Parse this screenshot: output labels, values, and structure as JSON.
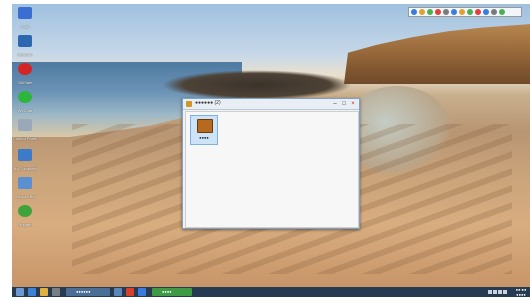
{
  "desktop": {
    "icons": [
      {
        "name": "computer-icon",
        "label": "Lilab",
        "color": "#3a6fd1"
      },
      {
        "name": "network-icon",
        "label": "Network",
        "color": "#2c67b0"
      },
      {
        "name": "antivirus-icon",
        "label": "360Safe",
        "color": "#d42424"
      },
      {
        "name": "chat-app-icon",
        "label": "WeChat",
        "color": "#2db53c"
      },
      {
        "name": "control-panel-icon",
        "label": "Control Panel",
        "color": "#9aa8b8"
      },
      {
        "name": "document-icon",
        "label": "My Computer",
        "color": "#3d7ac7"
      },
      {
        "name": "user-folder-icon",
        "label": "Recycle Bin",
        "color": "#5a8fd0"
      },
      {
        "name": "app-icon",
        "label": "Program",
        "color": "#3ea33a"
      }
    ]
  },
  "window": {
    "title": "●●●●●● (2)",
    "controls": {
      "minimize": "–",
      "maximize": "□",
      "close": "×"
    },
    "items": [
      {
        "label": "●●●●",
        "icon": "monitor-icon"
      }
    ]
  },
  "top_tray": {
    "icon_colors": [
      "#3b7be0",
      "#e0a030",
      "#4caf50",
      "#e04040",
      "#7a7a7a",
      "#3b7be0",
      "#e0a030",
      "#4caf50",
      "#e04040",
      "#3b7be0",
      "#7a7a7a",
      "#4caf50"
    ]
  },
  "taskbar": {
    "tasks": [
      {
        "label": "●●●●●●",
        "color": "#4a6e96"
      },
      {
        "label": "●●●●",
        "color": "#3e9a44"
      }
    ],
    "clock": {
      "time": "●●:●●",
      "date": "●●●●"
    }
  }
}
